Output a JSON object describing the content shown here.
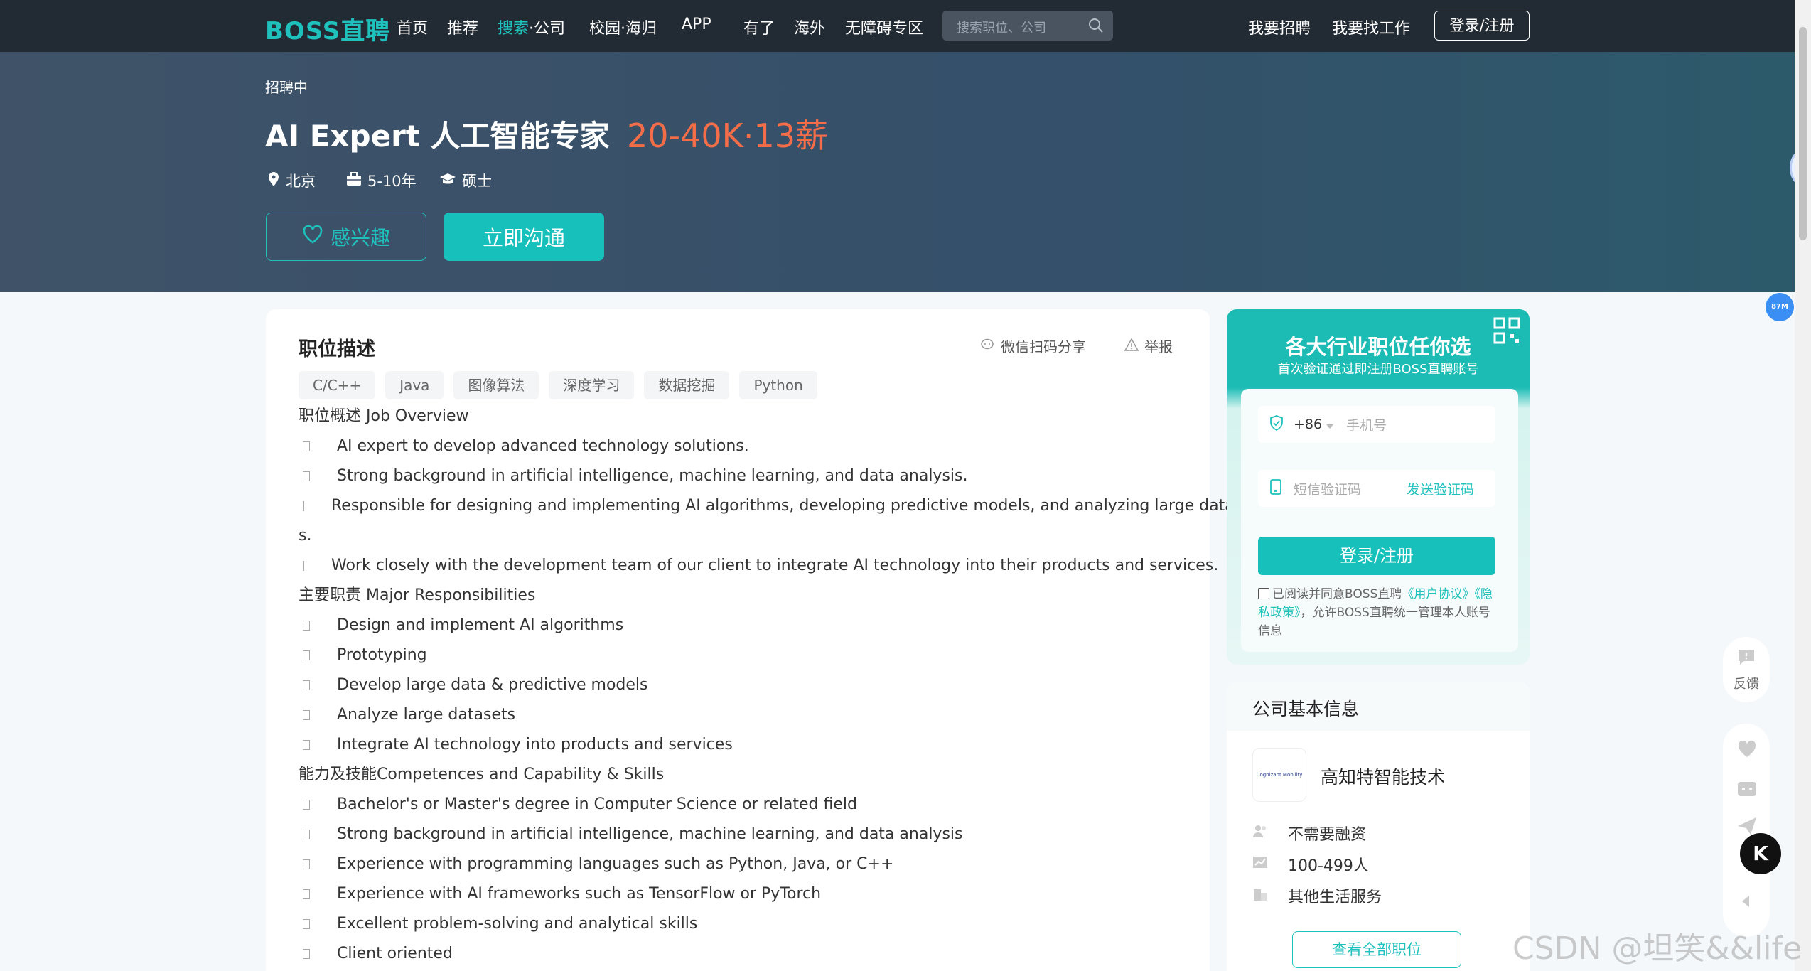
{
  "nav": {
    "logo": "BOSS直聘",
    "links": [
      "首页",
      "推荐"
    ],
    "search_company_hl": "搜索",
    "search_company_rest": "·公司",
    "campus": "校园·海归",
    "app": "APP",
    "youle": "有了",
    "overseas": "海外",
    "accessible": "无障碍专区",
    "search_placeholder": "搜索职位、公司",
    "recruit": "我要招聘",
    "find_job": "我要找工作",
    "login": "登录/注册"
  },
  "job": {
    "status": "招聘中",
    "title": "AI Expert 人工智能专家",
    "salary": "20-40K·13薪",
    "city": "北京",
    "experience": "5-10年",
    "degree": "硕士",
    "interest_btn": "感兴趣",
    "chat_btn": "立即沟通"
  },
  "desc": {
    "title": "职位描述",
    "share": "微信扫码分享",
    "report": "举报",
    "tags": [
      "C/C++",
      "Java",
      "图像算法",
      "深度学习",
      "数据挖掘",
      "Python"
    ],
    "lines": [
      {
        "t": "职位概述 Job Overview",
        "b": false
      },
      {
        "t": "AI expert to develop advanced technology solutions.",
        "b": true
      },
      {
        "t": "Strong background in artificial intelligence, machine learning, and data analysis.",
        "b": true
      },
      {
        "t": "Responsible for designing and implementing AI algorithms, developing predictive models, and analyzing large dataset",
        "b": true
      },
      {
        "t": "s.",
        "b": false
      },
      {
        "t": "Work closely with the development team of our client to integrate AI technology into their products and services.",
        "b": true
      },
      {
        "t": "主要职责 Major Responsibilities",
        "b": false
      },
      {
        "t": "Design and implement AI algorithms",
        "b": true
      },
      {
        "t": "Prototyping",
        "b": true
      },
      {
        "t": "Develop large data & predictive models",
        "b": true
      },
      {
        "t": "Analyze large datasets",
        "b": true
      },
      {
        "t": "Integrate AI technology into products and services",
        "b": true
      },
      {
        "t": "能力及技能Competences and Capability & Skills",
        "b": false
      },
      {
        "t": "Bachelor's or Master's degree in Computer Science or related field",
        "b": true
      },
      {
        "t": "Strong background in artificial intelligence, machine learning, and data analysis",
        "b": true
      },
      {
        "t": "Experience with programming languages such as Python, Java, or C++",
        "b": true
      },
      {
        "t": "Experience with AI frameworks such as TensorFlow or PyTorch",
        "b": true
      },
      {
        "t": "Excellent problem-solving and analytical skills",
        "b": true
      },
      {
        "t": "Client oriented",
        "b": true
      }
    ]
  },
  "login_panel": {
    "title": "各大行业职位任你选",
    "subtitle": "首次验证通过即注册BOSS直聘账号",
    "country_code": "+86",
    "phone_placeholder": "手机号",
    "code_placeholder": "短信验证码",
    "send_code": "发送验证码",
    "submit": "登录/注册",
    "agree_prefix": "已阅读并同意BOSS直聘",
    "user_agreement": "《用户协议》",
    "privacy": "《隐私政策》",
    "agree_suffix": "，允许BOSS直聘统一管理本人账号信息"
  },
  "company": {
    "title": "公司基本信息",
    "logo_text": "Cognizant Mobility",
    "name": "高知特智能技术",
    "financing": "不需要融资",
    "size": "100-499人",
    "industry": "其他生活服务",
    "view_all": "查看全部职位"
  },
  "floating": {
    "badge": "87M",
    "feedback": "反馈",
    "k_logo": "K"
  },
  "watermark": "CSDN @坦笑&&life",
  "colors": {
    "accent": "#1fc1bd",
    "salary": "#f26d48",
    "nav_bg": "#222a33"
  }
}
